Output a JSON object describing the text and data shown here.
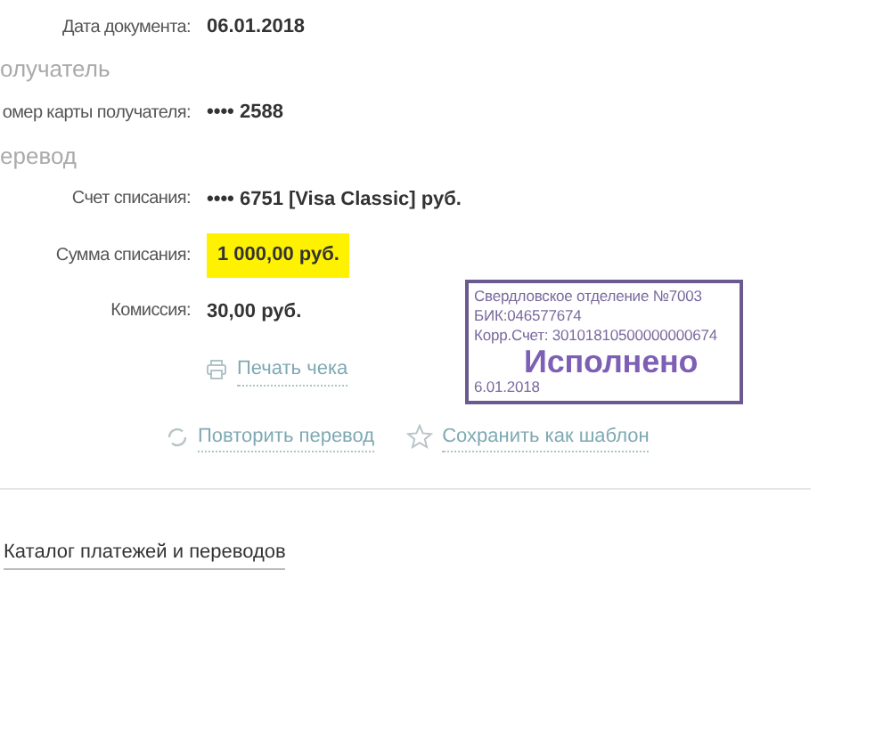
{
  "top_rows": [
    {
      "label": "Дата документа:",
      "value": "06.01.2018"
    }
  ],
  "sections": [
    {
      "title": "олучатель",
      "rows": [
        {
          "label": "омер карты получателя:",
          "value": "•••• 2588"
        }
      ]
    },
    {
      "title": "еревод",
      "rows": [
        {
          "label": "Счет списания:",
          "value": "•••• 6751  [Visa Classic]  руб.",
          "highlighted": false
        },
        {
          "label": "Сумма списания:",
          "value": "1 000,00  руб.",
          "highlighted": true
        },
        {
          "label": "Комиссия:",
          "value": "30,00 руб.",
          "highlighted": false
        }
      ]
    }
  ],
  "print_link": "Печать чека",
  "actions": [
    {
      "kind": "repeat",
      "label": "Повторить перевод"
    },
    {
      "kind": "template",
      "label": "Сохранить как шаблон"
    }
  ],
  "stamp": {
    "lines": [
      "Свердловское отделение №7003",
      "БИК:046577674",
      "Корр.Счет: 30101810500000000674"
    ],
    "status": "Исполнено",
    "date": "6.01.2018"
  },
  "catalog_link": "Каталог платежей и переводов"
}
